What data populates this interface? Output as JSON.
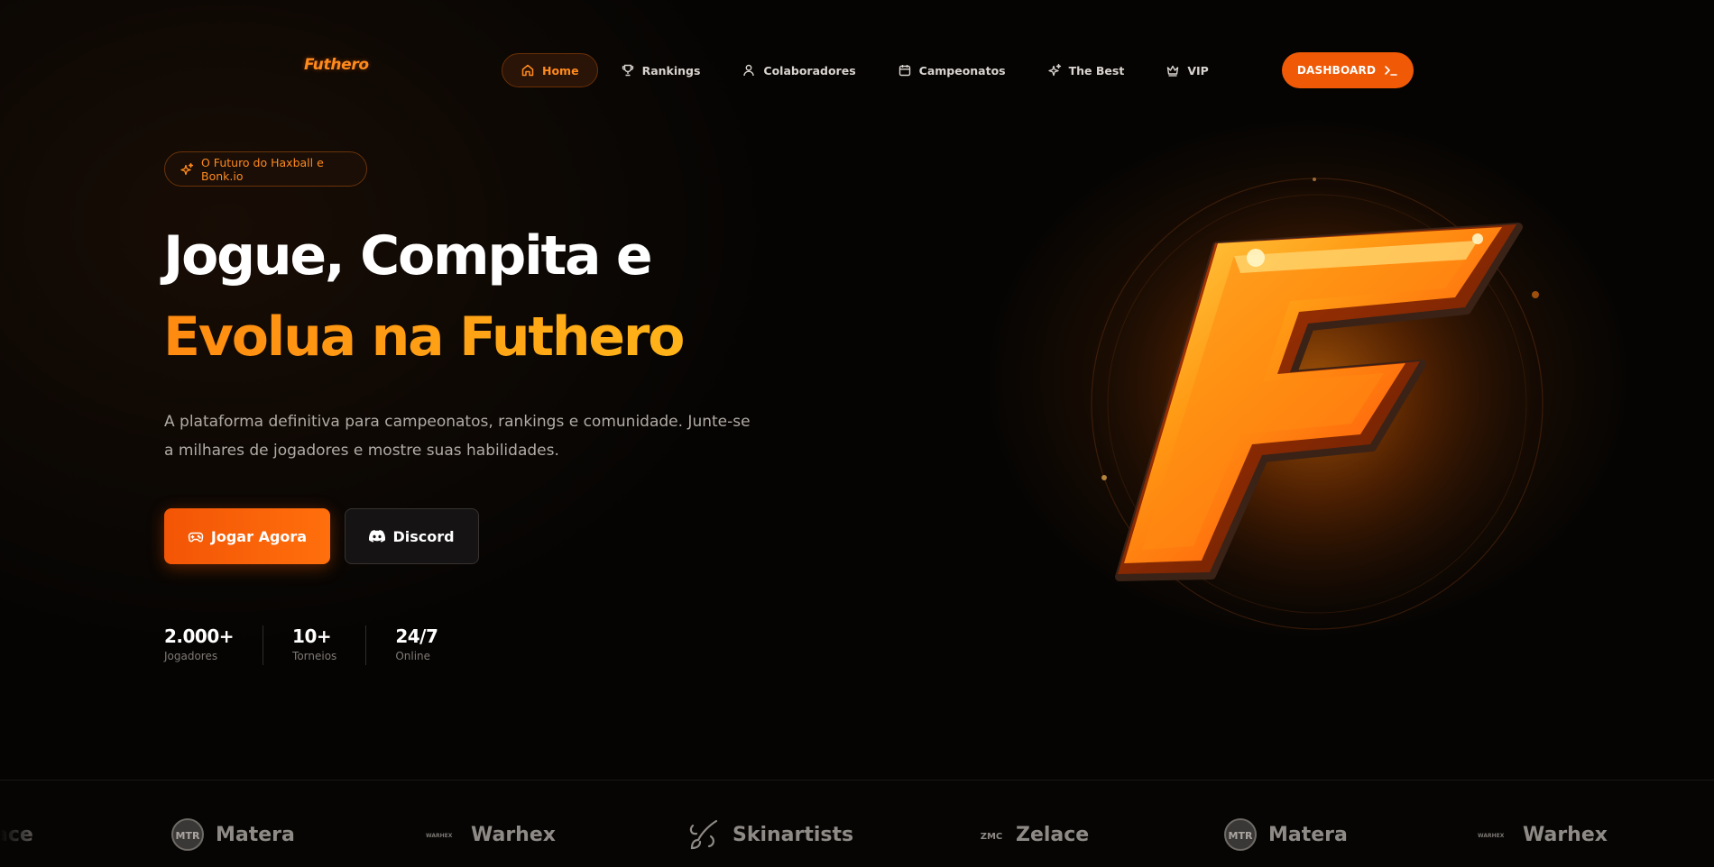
{
  "brand": {
    "logo": "Futhero"
  },
  "nav": {
    "items": [
      {
        "label": "Home",
        "icon": "home-icon",
        "active": true
      },
      {
        "label": "Rankings",
        "icon": "trophy-icon"
      },
      {
        "label": "Colaboradores",
        "icon": "user-icon"
      },
      {
        "label": "Campeonatos",
        "icon": "calendar-icon"
      },
      {
        "label": "The Best",
        "icon": "sparkles-icon"
      },
      {
        "label": "VIP",
        "icon": "crown-icon"
      }
    ],
    "cta": "DASHBOARD"
  },
  "hero": {
    "badge": "O Futuro do Haxball e Bonk.io",
    "title_line1": "Jogue, Compita e",
    "title_line2": "Evolua na Futhero",
    "description": "A plataforma definitiva para campeonatos, rankings e comunidade. Junte-se a milhares de jogadores e mostre suas habilidades.",
    "primary_button": "Jogar Agora",
    "secondary_button": "Discord",
    "stats": [
      {
        "value": "2.000+",
        "label": "Jogadores"
      },
      {
        "value": "10+",
        "label": "Torneios"
      },
      {
        "value": "24/7",
        "label": "Online"
      }
    ]
  },
  "partners": [
    {
      "name": "ace",
      "mark": ""
    },
    {
      "name": "Matera",
      "mark": "MTR"
    },
    {
      "name": "Warhex",
      "mark": "WARHEX"
    },
    {
      "name": "Skinartists",
      "mark": ""
    },
    {
      "name": "Zelace",
      "mark": "ZMC"
    },
    {
      "name": "Matera",
      "mark": "MTR"
    },
    {
      "name": "Warhex",
      "mark": "WARHEX"
    }
  ],
  "colors": {
    "accent": "#f05a06",
    "accent_text": "#ff8a1e",
    "title_gold": "#ffa411",
    "background": "#050403"
  }
}
